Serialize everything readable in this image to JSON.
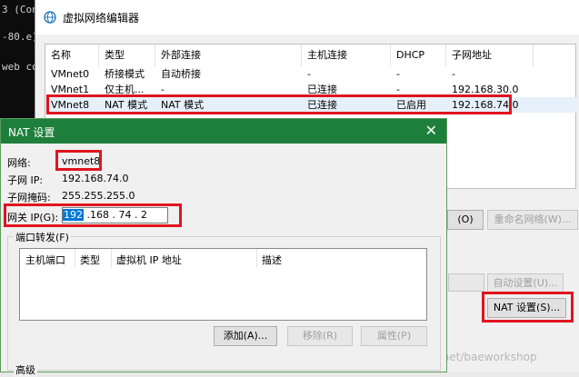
{
  "console": {
    "lines": [
      "3 (Con",
      "-80.e)",
      "",
      "web co"
    ]
  },
  "editor": {
    "title": "虚拟网络编辑器",
    "columns": [
      "名称",
      "类型",
      "外部连接",
      "主机连接",
      "DHCP",
      "子网地址"
    ],
    "rows": [
      [
        "VMnet0",
        "桥接模式",
        "自动桥接",
        "-",
        "-",
        "-"
      ],
      [
        "VMnet1",
        "仅主机...",
        "-",
        "已连接",
        "-",
        "192.168.30.0"
      ],
      [
        "VMnet8",
        "NAT 模式",
        "NAT 模式",
        "已连接",
        "已启用",
        "192.168.74.0"
      ]
    ],
    "btn_remove_partial": "(O)",
    "btn_rename": "重命名网络(W)...",
    "btn_auto": "自动设置(U)...",
    "btn_nat": "NAT 设置(S)..."
  },
  "nat": {
    "title": "NAT 设置",
    "close": "✕",
    "network_label": "网络:",
    "network_value": "vmnet8",
    "subnet_ip_label": "子网 IP:",
    "subnet_ip_value": "192.168.74.0",
    "mask_label": "子网掩码:",
    "mask_value": "255.255.255.0",
    "gateway_label": "网关 IP(G):",
    "gateway_oct1": "192",
    "gateway_rest": " .168 . 74  .  2",
    "port_forward_label": "端口转发(F)",
    "pf_columns": [
      "主机端口",
      "类型",
      "虚拟机 IP 地址",
      "描述"
    ],
    "btn_add": "添加(A)...",
    "btn_remove": "移除(R)",
    "btn_props": "属性(P)",
    "advanced_label": "高级"
  },
  "watermark": "https://blog.csdn.net/baeworkshop"
}
